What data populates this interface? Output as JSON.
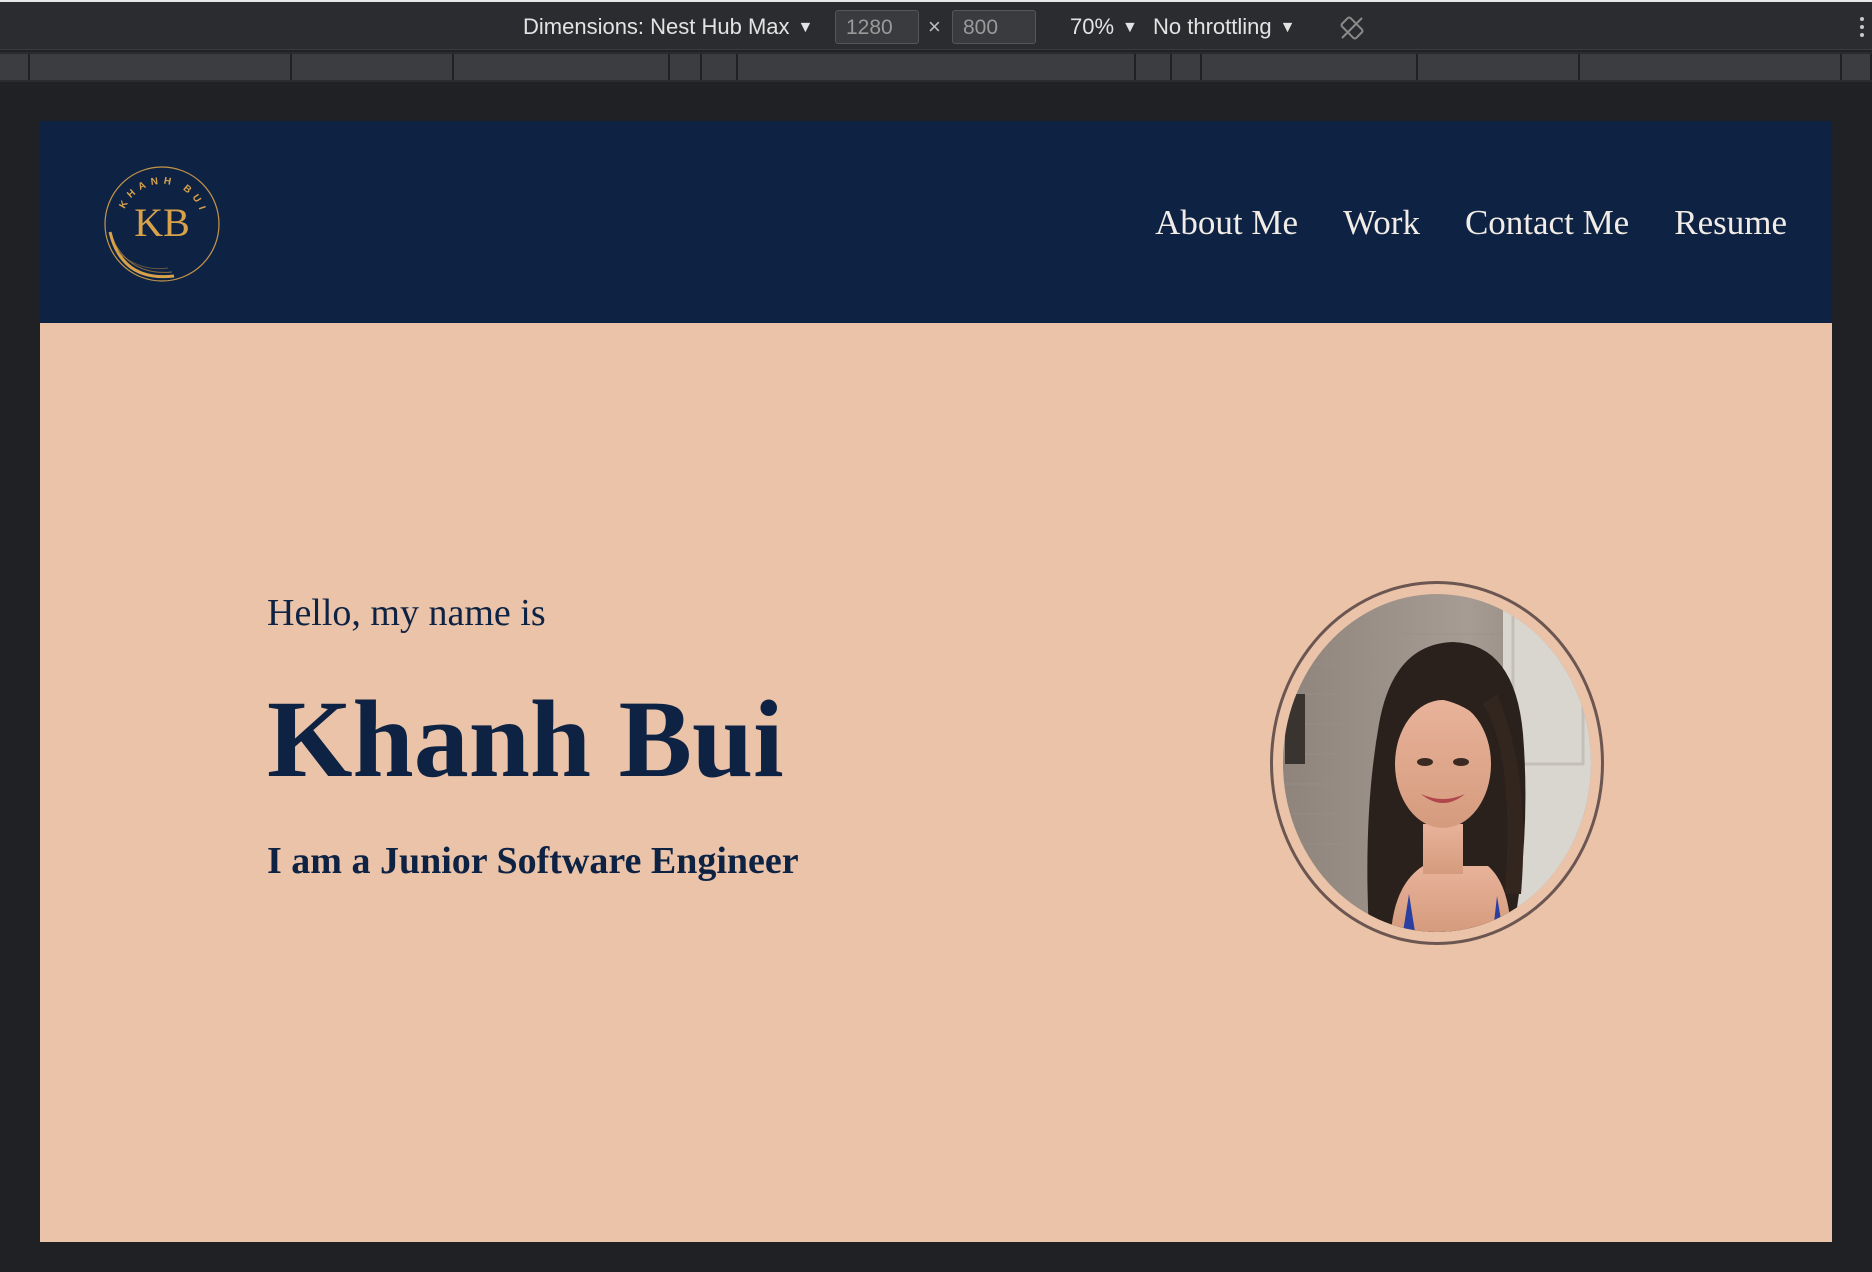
{
  "devtools": {
    "device_label": "Dimensions: Nest Hub Max",
    "width_value": "1280",
    "height_value": "800",
    "times_symbol": "×",
    "zoom": "70%",
    "throttling": "No throttling",
    "rotate_icon": "rotate-icon",
    "more_icon": "kebab-icon"
  },
  "site": {
    "logo": {
      "ring_text": "KHANH BUI",
      "monogram": "KB",
      "colors": {
        "gold": "#d8a24a",
        "navy": "#0e2344"
      }
    },
    "nav": [
      {
        "label": "About Me"
      },
      {
        "label": "Work"
      },
      {
        "label": "Contact Me"
      },
      {
        "label": "Resume"
      }
    ],
    "hero": {
      "greeting": "Hello, my name is",
      "name": "Khanh Bui",
      "tagline": "I am a Junior Software Engineer"
    }
  },
  "colors": {
    "header_bg": "#0e2344",
    "hero_bg": "#ebc3a9",
    "text": "#0e2344",
    "devtools_bg": "#202124"
  }
}
